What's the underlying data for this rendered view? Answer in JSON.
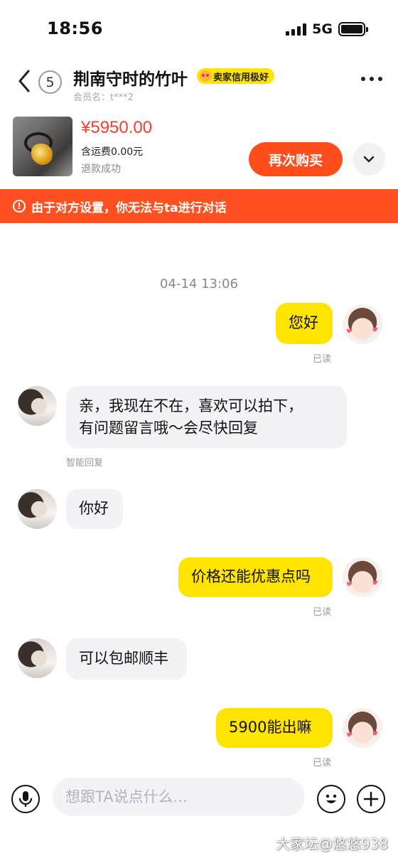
{
  "status_bar": {
    "time": "18:56",
    "network": "5G"
  },
  "header": {
    "unread_count": "5",
    "seller_name": "荆南守时的竹叶",
    "credit_badge": "卖家信用极好",
    "member_name": "会员名：t***2"
  },
  "product": {
    "price": "¥5950.00",
    "shipping": "含运费0.00元",
    "status": "退款成功",
    "rebuy_label": "再次购买"
  },
  "warning": {
    "text": "由于对方设置，你无法与ta进行对话",
    "color": "#ff5022"
  },
  "chat": {
    "timestamp": "04-14 13:06",
    "messages": [
      {
        "from": "me",
        "text": "您好",
        "status": "已读"
      },
      {
        "from": "seller",
        "lines": [
          "亲，我现在不在，喜欢可以拍下，",
          "有问题留言哦～会尽快回复"
        ],
        "note": "智能回复"
      },
      {
        "from": "seller",
        "text": "你好"
      },
      {
        "from": "me",
        "text": "价格还能优惠点吗",
        "status": "已读"
      },
      {
        "from": "seller",
        "text": "可以包邮顺丰"
      },
      {
        "from": "me",
        "text": "5900能出嘛",
        "status": "已读"
      }
    ]
  },
  "input": {
    "placeholder": "想跟TA说点什么..."
  },
  "watermark": "大家坛@悠悠938",
  "colors": {
    "accent_yellow": "#ffe400",
    "price_red": "#ff3b30",
    "button_orange": "#ff4d1c"
  }
}
